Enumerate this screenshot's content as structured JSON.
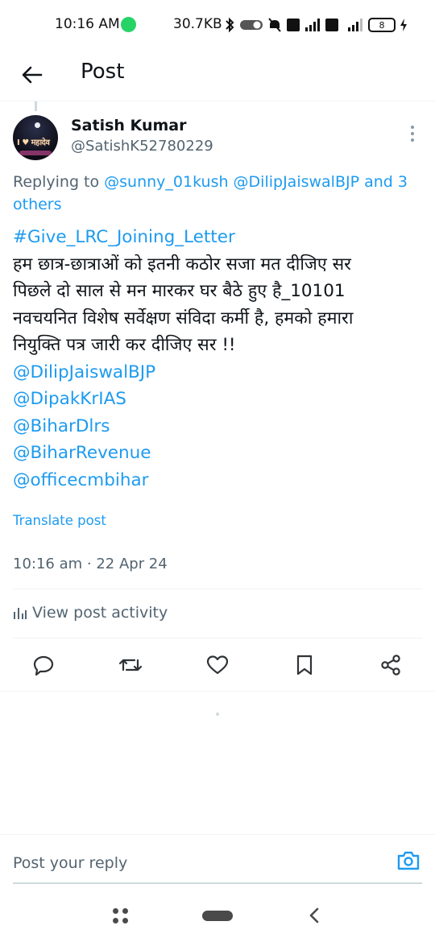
{
  "status_bar": {
    "time": "10:16 AM",
    "network_speed": "30.7KB",
    "battery_level": "8",
    "icons": [
      "whatsapp-icon",
      "bluetooth-icon",
      "toggle-icon",
      "mute-icon",
      "volte-icon",
      "signal-icon",
      "battery-icon",
      "charging-icon"
    ]
  },
  "header": {
    "title": "Post"
  },
  "post": {
    "author_name": "Satish Kumar",
    "author_handle": "@SatishK52780229",
    "replying_prefix": "Replying to ",
    "replying_mentions": "@sunny_01kush @DilipJaiswalBJP",
    "replying_conj": " and ",
    "replying_others": "3 others",
    "hashtag": "#Give_LRC_Joining_Letter",
    "body_lines": [
      "हम छात्र-छात्राओं को इतनी कठोर सजा मत दीजिए सर",
      "पिछले दो साल से मन मारकर घर बैठे हुए है_10101",
      "नवचयनित विशेष सर्वेक्षण संविदा कर्मी है, हमको हमारा",
      "नियुक्ति पत्र जारी कर दीजिए सर !!"
    ],
    "mentions": [
      "@DilipJaiswalBJP",
      "@DipakKrIAS",
      "@BiharDlrs",
      "@BiharRevenue",
      "@officecmbihar"
    ],
    "translate_label": "Translate post",
    "timestamp": "10:16 am · 22 Apr 24",
    "activity_label": "View post activity"
  },
  "actions": [
    "reply-icon",
    "repost-icon",
    "like-icon",
    "bookmark-icon",
    "share-icon"
  ],
  "reply_bar": {
    "placeholder": "Post your reply"
  },
  "colors": {
    "link": "#1d9bf0",
    "text": "#0f1419",
    "secondary": "#536471",
    "divider": "#eff3f4"
  }
}
